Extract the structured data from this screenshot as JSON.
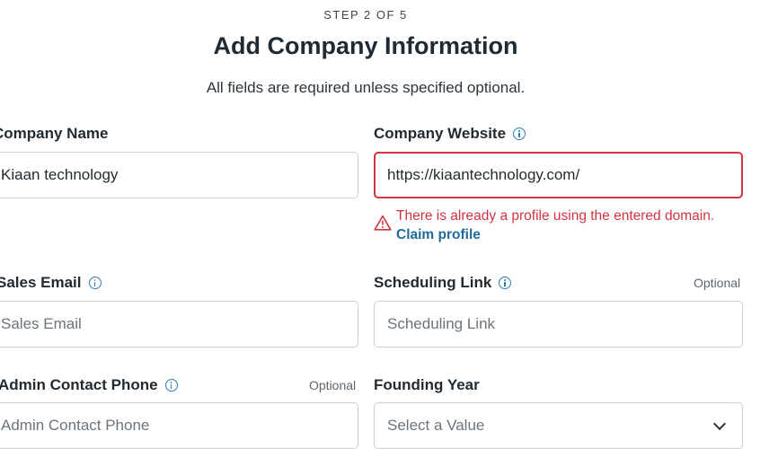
{
  "header": {
    "step": "STEP 2 OF 5",
    "title": "Add Company Information",
    "subtitle": "All fields are required unless specified optional."
  },
  "fields": {
    "company_name": {
      "label": "Company Name",
      "value": "Kiaan technology"
    },
    "company_website": {
      "label": "Company Website",
      "value": "https://kiaantechnology.com/",
      "error": "There is already a profile using the entered domain.",
      "error_link": "Claim profile"
    },
    "sales_email": {
      "label": "Sales Email",
      "placeholder": "Sales Email"
    },
    "scheduling_link": {
      "label": "Scheduling Link",
      "optional": "Optional",
      "placeholder": "Scheduling Link"
    },
    "admin_phone": {
      "label": "Admin Contact Phone",
      "optional": "Optional",
      "placeholder": "Admin Contact Phone"
    },
    "founding_year": {
      "label": "Founding Year",
      "placeholder": "Select a Value"
    }
  },
  "colors": {
    "error": "#d3343f",
    "link": "#216b99",
    "info": "#2b7fb0",
    "border": "#c9cfd4"
  },
  "icons": [
    "info-icon",
    "warning-icon",
    "chevron-down-icon"
  ]
}
